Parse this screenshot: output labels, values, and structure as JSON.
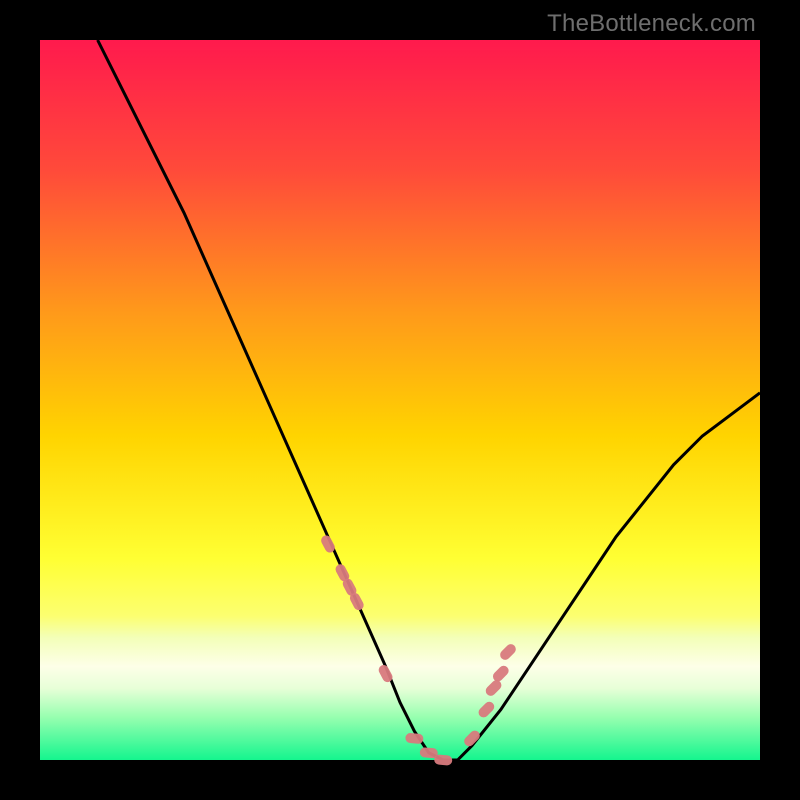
{
  "watermark": "TheBottleneck.com",
  "colors": {
    "gradient_top": "#ff1a4d",
    "gradient_mid1": "#ff7a1a",
    "gradient_mid2": "#ffd400",
    "gradient_mid3": "#ffff55",
    "gradient_band": "#f6ffb0",
    "gradient_bottom": "#14f58e",
    "curve": "#000000",
    "marker": "#d87a7d",
    "frame": "#000000"
  },
  "chart_data": {
    "type": "line",
    "title": "",
    "xlabel": "",
    "ylabel": "",
    "xlim": [
      0,
      100
    ],
    "ylim": [
      0,
      100
    ],
    "series": [
      {
        "name": "bottleneck-curve",
        "x": [
          8,
          12,
          16,
          20,
          24,
          28,
          32,
          36,
          40,
          44,
          48,
          50,
          52,
          54,
          56,
          58,
          60,
          64,
          68,
          72,
          76,
          80,
          84,
          88,
          92,
          96,
          100
        ],
        "y": [
          100,
          92,
          84,
          76,
          67,
          58,
          49,
          40,
          31,
          22,
          13,
          8,
          4,
          1,
          0,
          0,
          2,
          7,
          13,
          19,
          25,
          31,
          36,
          41,
          45,
          48,
          51
        ]
      }
    ],
    "markers": {
      "name": "highlighted-points",
      "x": [
        40,
        42,
        43,
        44,
        48,
        52,
        54,
        56,
        60,
        62,
        63,
        64,
        65
      ],
      "y": [
        30,
        26,
        24,
        22,
        12,
        3,
        1,
        0,
        3,
        7,
        10,
        12,
        15
      ]
    },
    "annotations": []
  }
}
